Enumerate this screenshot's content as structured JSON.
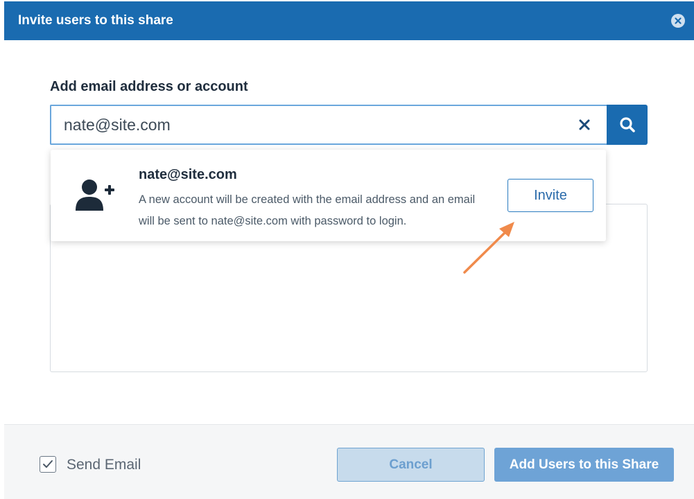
{
  "dialog": {
    "title": "Invite users to this share"
  },
  "search": {
    "label": "Add email address or account",
    "value": "nate@site.com",
    "clear_icon": "close-x-icon",
    "search_icon": "search-icon"
  },
  "suggestion": {
    "icon": "user-plus-icon",
    "email": "nate@site.com",
    "description": "A new account will be created with the email address and an email will be sent to nate@site.com with password to login.",
    "invite_label": "Invite"
  },
  "annotation": {
    "arrow_color": "#f08a4b"
  },
  "footer": {
    "send_email_checked": true,
    "send_email_label": "Send Email",
    "cancel_label": "Cancel",
    "add_label": "Add Users to this Share"
  },
  "colors": {
    "primary": "#1a6bb0",
    "disabled_primary": "#6ea3d6"
  }
}
